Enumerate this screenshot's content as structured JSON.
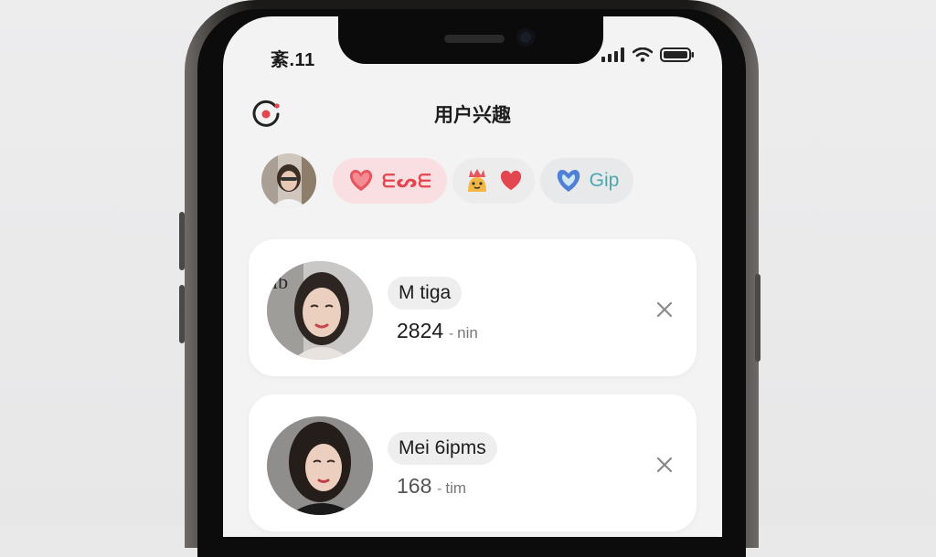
{
  "status_bar": {
    "time": "紊.11"
  },
  "header": {
    "title": "用户兴趣",
    "icon": "target-icon"
  },
  "interest_chips": [
    {
      "label": "ᗴᔕᗴ",
      "icon": "heart-icon",
      "color": "#e8545f",
      "bg": "#f9dfe1"
    },
    {
      "label": "",
      "icons": [
        "mascot-icon",
        "heart-icon"
      ],
      "color": "#e8545f",
      "bg": "#ececed"
    },
    {
      "label": "Gip",
      "icon": "heart-shield-icon",
      "color": "#4aa9b0",
      "bg": "#e8e9ea"
    }
  ],
  "profiles": [
    {
      "name": "M tiga",
      "value": "2824",
      "sep": "-",
      "unit": "nin"
    },
    {
      "name": "Mei 6ipms",
      "value": "168",
      "sep": "-",
      "unit": "tim"
    }
  ],
  "colors": {
    "accent_red": "#e3464f",
    "screen_bg": "#f3f3f4",
    "card_bg": "#ffffff"
  }
}
